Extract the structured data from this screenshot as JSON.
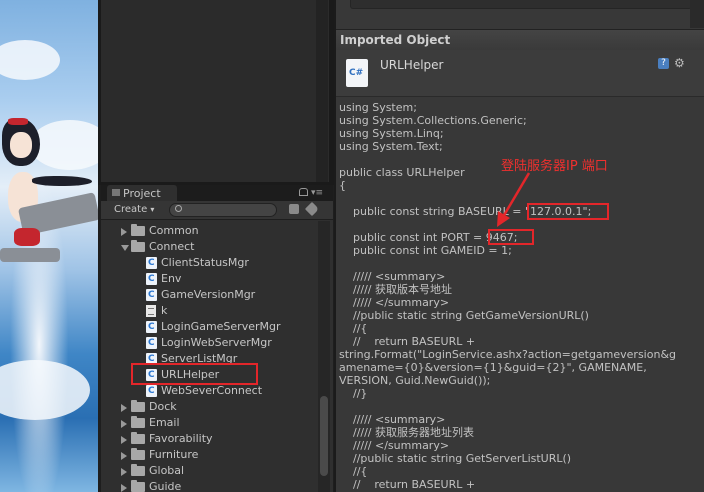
{
  "project": {
    "tab_label": "Project",
    "create_label": "Create",
    "tree": [
      {
        "label": "Common",
        "kind": "folder",
        "expanded": false
      },
      {
        "label": "Connect",
        "kind": "folder",
        "expanded": true
      },
      {
        "label": "ClientStatusMgr",
        "kind": "script"
      },
      {
        "label": "Env",
        "kind": "script"
      },
      {
        "label": "GameVersionMgr",
        "kind": "script"
      },
      {
        "label": "k",
        "kind": "text"
      },
      {
        "label": "LoginGameServerMgr",
        "kind": "script"
      },
      {
        "label": "LoginWebServerMgr",
        "kind": "script"
      },
      {
        "label": "ServerListMgr",
        "kind": "script"
      },
      {
        "label": "URLHelper",
        "kind": "script",
        "selected": true
      },
      {
        "label": "WebSeverConnect",
        "kind": "script"
      },
      {
        "label": "Dock",
        "kind": "folder",
        "expanded": false
      },
      {
        "label": "Email",
        "kind": "folder",
        "expanded": false
      },
      {
        "label": "Favorability",
        "kind": "folder",
        "expanded": false
      },
      {
        "label": "Furniture",
        "kind": "folder",
        "expanded": false
      },
      {
        "label": "Global",
        "kind": "folder",
        "expanded": false
      },
      {
        "label": "Guide",
        "kind": "folder",
        "expanded": false
      }
    ]
  },
  "inspector": {
    "section_title": "Imported Object",
    "file_name": "URLHelper",
    "code_lines": [
      "using System;",
      "using System.Collections.Generic;",
      "using System.Linq;",
      "using System.Text;",
      "",
      "public class URLHelper",
      "{",
      "",
      "    public const string BASEURL = \"127.0.0.1\";",
      "",
      "    public const int PORT = 9467;",
      "    public const int GAMEID = 1;",
      "",
      "    ///// <summary>",
      "    ///// 获取版本号地址",
      "    ///// </summary>",
      "    //public static string GetGameVersionURL()",
      "    //{",
      "    //    return BASEURL +",
      "string.Format(\"LoginService.ashx?action=getgameversion&g",
      "amename={0}&version={1}&guid={2}\", GAMENAME,",
      "VERSION, Guid.NewGuid());",
      "    //}",
      "",
      "    ///// <summary>",
      "    ///// 获取服务器地址列表",
      "    ///// </summary>",
      "    //public static string GetServerListURL()",
      "    //{",
      "    //    return BASEURL +"
    ]
  },
  "annotation": {
    "text": "登陆服务器IP 端口",
    "color": "#e3262a"
  }
}
